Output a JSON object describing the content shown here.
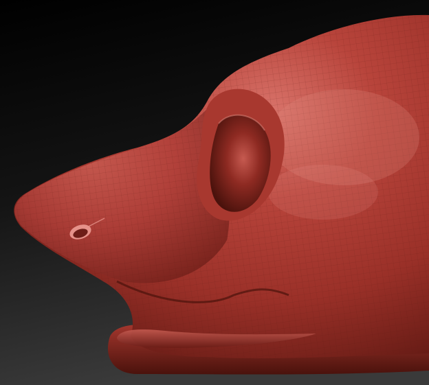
{
  "scene": {
    "subject": "sculpted-animal-head-mesh",
    "view": "side-profile-facing-left",
    "background_gradient": [
      "#000000",
      "#3a3a3a"
    ],
    "clay_colors": {
      "light": "#d9736a",
      "base": "#b8443b",
      "mid": "#9a3028",
      "dark": "#5e1812",
      "deep": "#3a0c08"
    },
    "wireframe_color": "#5a1a14",
    "features": {
      "ear": true,
      "nostril": true,
      "mouth": true,
      "chin": true,
      "polygon_wireframe": true
    }
  }
}
